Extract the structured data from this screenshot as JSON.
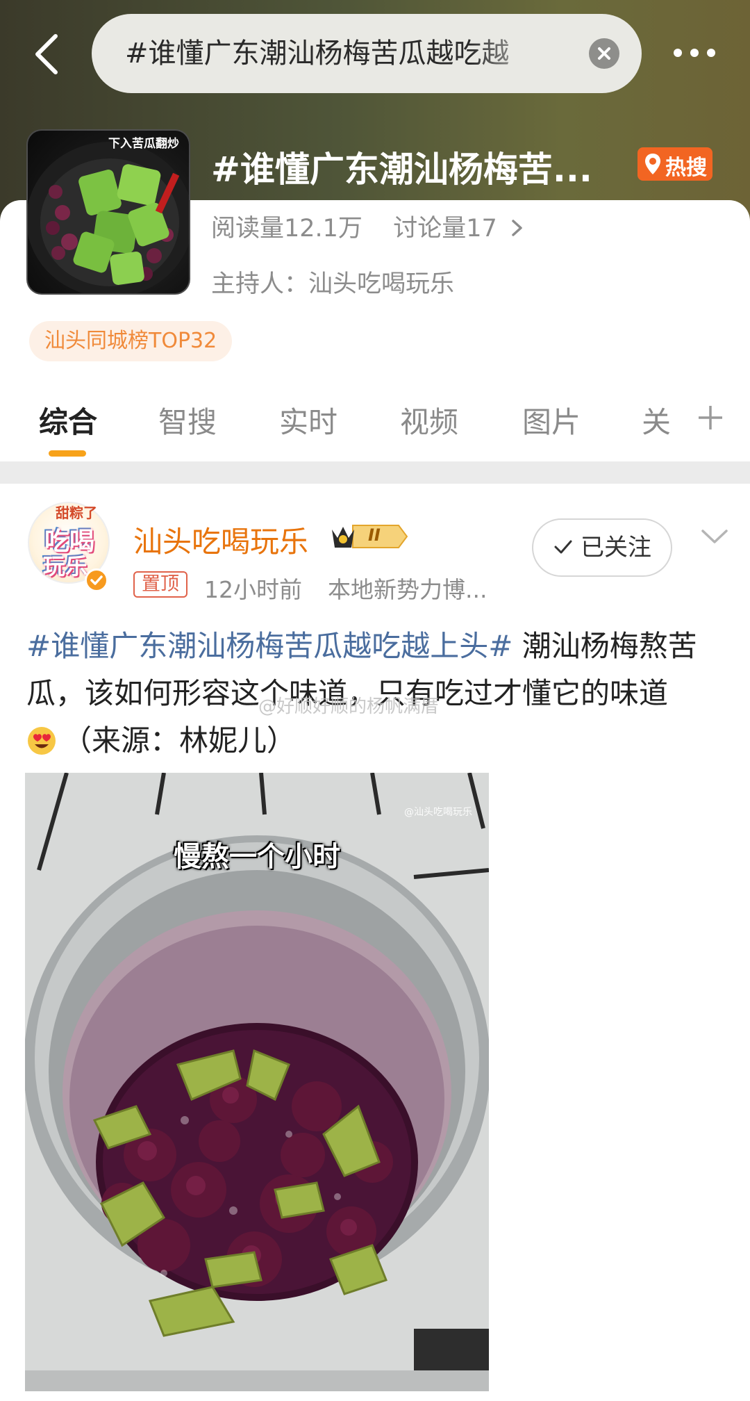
{
  "header": {
    "search_query": "#谁懂广东潮汕杨梅苦瓜越吃越",
    "clear_icon": "close-icon",
    "more_icon": "more-icon",
    "back_icon": "back-icon"
  },
  "topic": {
    "title": "#谁懂广东潮汕杨梅苦...",
    "thumbnail_caption": "下入苦瓜翻炒",
    "hot_badge": "热搜",
    "reads": "阅读量12.1万",
    "discussions": "讨论量17",
    "host": "主持人：汕头吃喝玩乐",
    "rank_tag": "汕头同城榜TOP32"
  },
  "tabs": [
    {
      "label": "综合"
    },
    {
      "label": "智搜"
    },
    {
      "label": "实时"
    },
    {
      "label": "视频"
    },
    {
      "label": "图片"
    },
    {
      "label": "关"
    }
  ],
  "post": {
    "author": "汕头吃喝玩乐",
    "level": "II",
    "avatar_text_top": "甜粽了",
    "avatar_text_main": "吃喝",
    "avatar_text_bottom": "玩乐",
    "pin_tag": "置顶",
    "time": "12小时前",
    "source": "本地新势力博...",
    "follow_label": "已关注",
    "hashtag": "#谁懂广东潮汕杨梅苦瓜越吃越上头#",
    "body_text": " 潮汕杨梅熬苦瓜，该如何形容这个味道，只有吃过才懂它的味道",
    "body_suffix": "（来源：林妮儿）",
    "watermark": "@好顺好顺的杨帆满厝",
    "image_caption": "慢熬一个小时",
    "image_watermark": "@汕头吃喝玩乐"
  },
  "colors": {
    "accent": "#f7a21a",
    "author": "#e8740c",
    "hashtag": "#4a6d9e",
    "hot": "#f26522"
  }
}
